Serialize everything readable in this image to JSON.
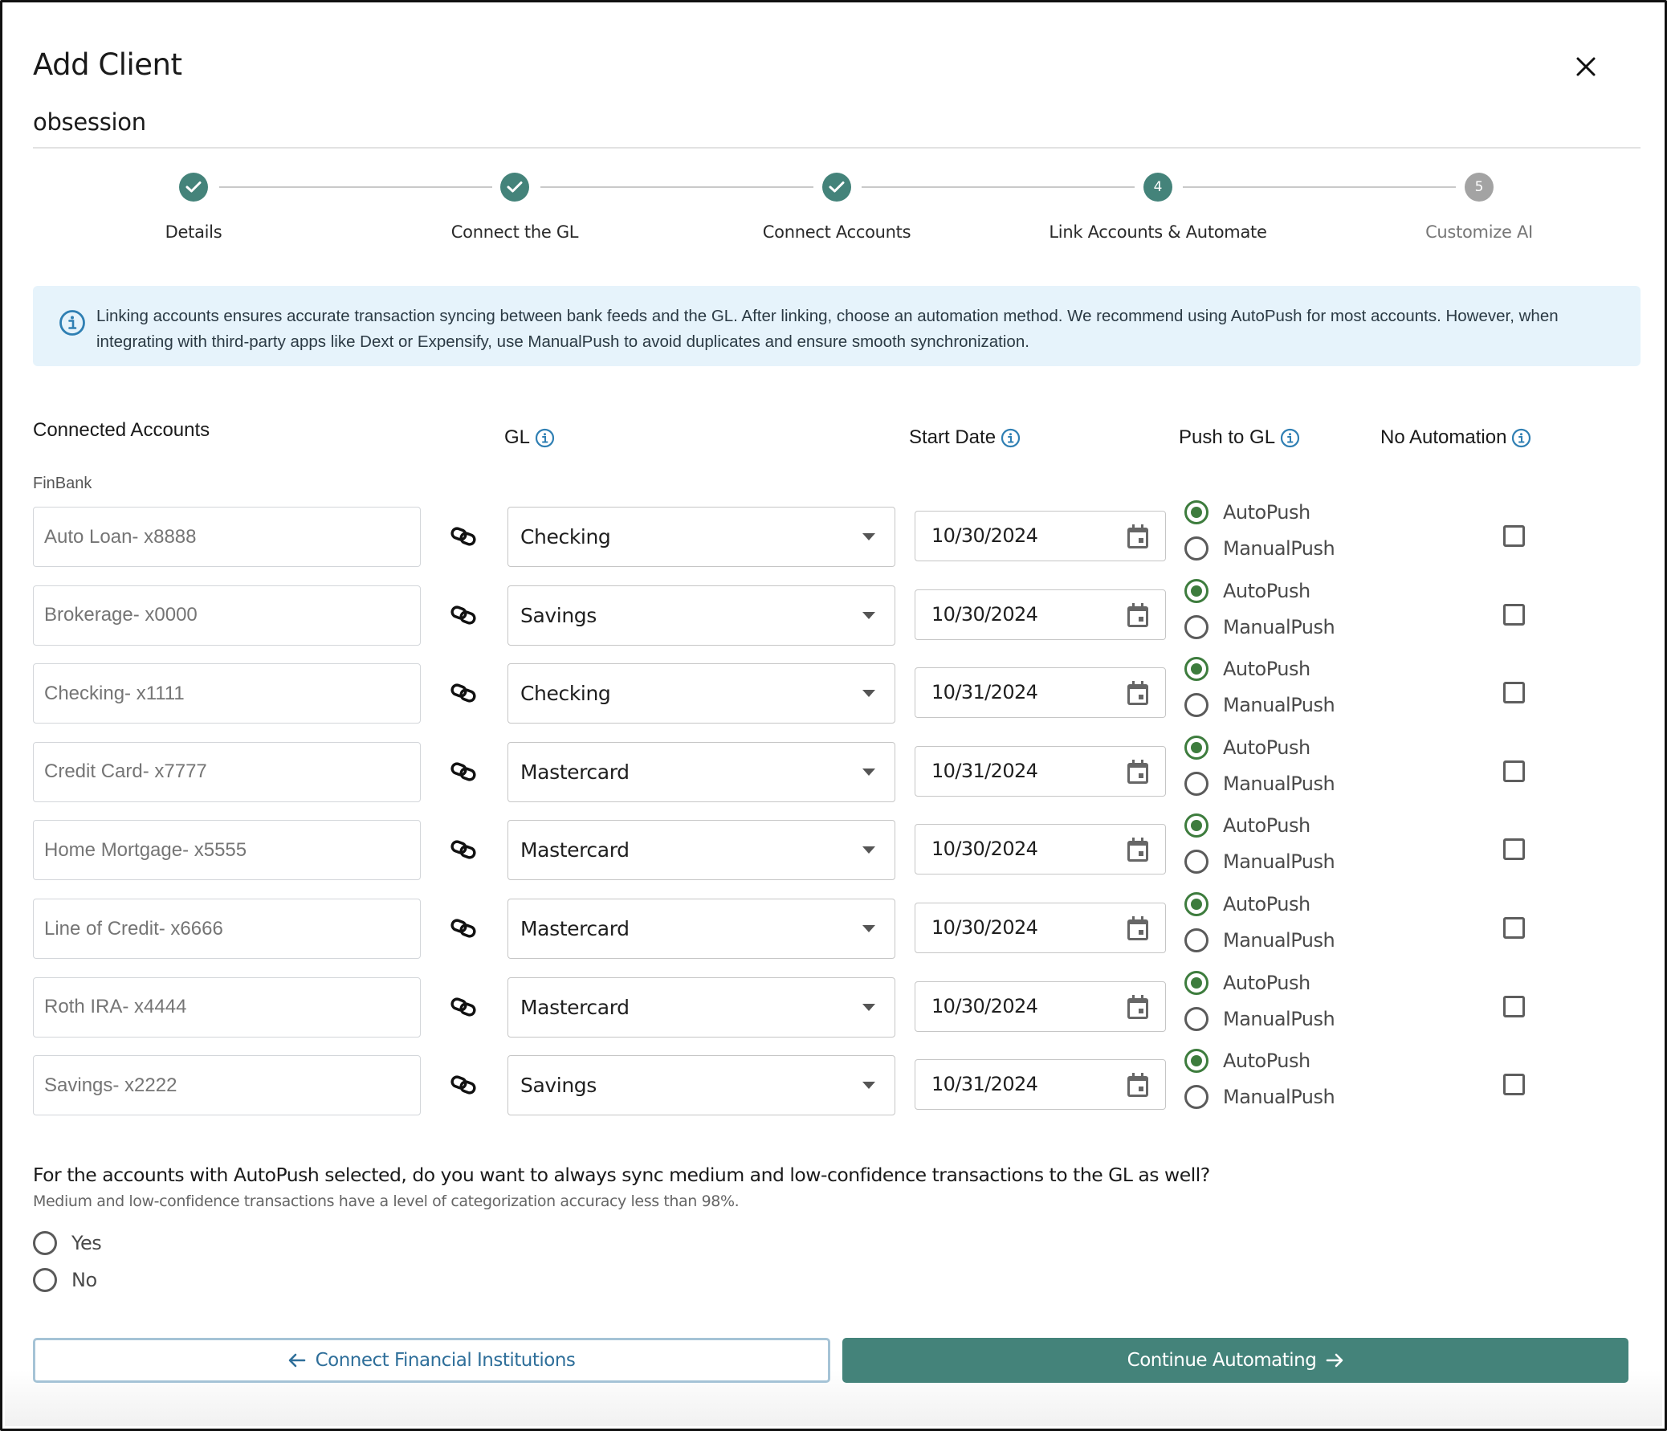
{
  "dialog": {
    "title": "Add Client",
    "client_name": "obsession",
    "close_icon": "close-icon"
  },
  "stepper": {
    "steps": [
      {
        "label": "Details",
        "state": "complete",
        "number": "1"
      },
      {
        "label": "Connect the GL",
        "state": "complete",
        "number": "2"
      },
      {
        "label": "Connect Accounts",
        "state": "complete",
        "number": "3"
      },
      {
        "label": "Link Accounts & Automate",
        "state": "active",
        "number": "4"
      },
      {
        "label": "Customize AI",
        "state": "pending",
        "number": "5"
      }
    ]
  },
  "banner": {
    "icon": "info-icon",
    "text": "Linking accounts ensures accurate transaction syncing between bank feeds and the GL. After linking, choose an automation method. We recommend using AutoPush for most accounts. However, when integrating with third-party apps like Dext or Expensify, use ManualPush to avoid duplicates and ensure smooth synchronization."
  },
  "columns": {
    "connected_accounts": "Connected Accounts",
    "gl": "GL",
    "start_date": "Start Date",
    "push_to_gl": "Push to GL",
    "no_automation": "No Automation"
  },
  "bank": "FinBank",
  "push_options": {
    "auto": "AutoPush",
    "manual": "ManualPush"
  },
  "rows": [
    {
      "account_placeholder": "Auto Loan- x8888",
      "gl": "Checking",
      "start_date": "10/30/2024",
      "push": "AutoPush",
      "no_automation": false
    },
    {
      "account_placeholder": "Brokerage- x0000",
      "gl": "Savings",
      "start_date": "10/30/2024",
      "push": "AutoPush",
      "no_automation": false
    },
    {
      "account_placeholder": "Checking- x1111",
      "gl": "Checking",
      "start_date": "10/31/2024",
      "push": "AutoPush",
      "no_automation": false
    },
    {
      "account_placeholder": "Credit Card- x7777",
      "gl": "Mastercard",
      "start_date": "10/31/2024",
      "push": "AutoPush",
      "no_automation": false
    },
    {
      "account_placeholder": "Home Mortgage- x5555",
      "gl": "Mastercard",
      "start_date": "10/30/2024",
      "push": "AutoPush",
      "no_automation": false
    },
    {
      "account_placeholder": "Line of Credit- x6666",
      "gl": "Mastercard",
      "start_date": "10/30/2024",
      "push": "AutoPush",
      "no_automation": false
    },
    {
      "account_placeholder": "Roth IRA- x4444",
      "gl": "Mastercard",
      "start_date": "10/30/2024",
      "push": "AutoPush",
      "no_automation": false
    },
    {
      "account_placeholder": "Savings- x2222",
      "gl": "Savings",
      "start_date": "10/31/2024",
      "push": "AutoPush",
      "no_automation": false
    }
  ],
  "confidence_question": {
    "question": "For the accounts with AutoPush selected, do you want to always sync medium and low-confidence transactions to the GL as well?",
    "help": "Medium and low-confidence transactions have a level of categorization accuracy less than 98%.",
    "options": [
      "Yes",
      "No"
    ],
    "selected": null
  },
  "footer": {
    "back_label": "Connect Financial Institutions",
    "next_label": "Continue Automating"
  },
  "colors": {
    "primary": "#44837a",
    "radio_selected": "#3d7c3d",
    "pending_step": "#a3a3a3",
    "banner_bg": "#e6f3fb",
    "info_icon": "#2f7fb3",
    "back_button_border": "#a5c3d6",
    "back_button_text": "#2f6f9a"
  }
}
